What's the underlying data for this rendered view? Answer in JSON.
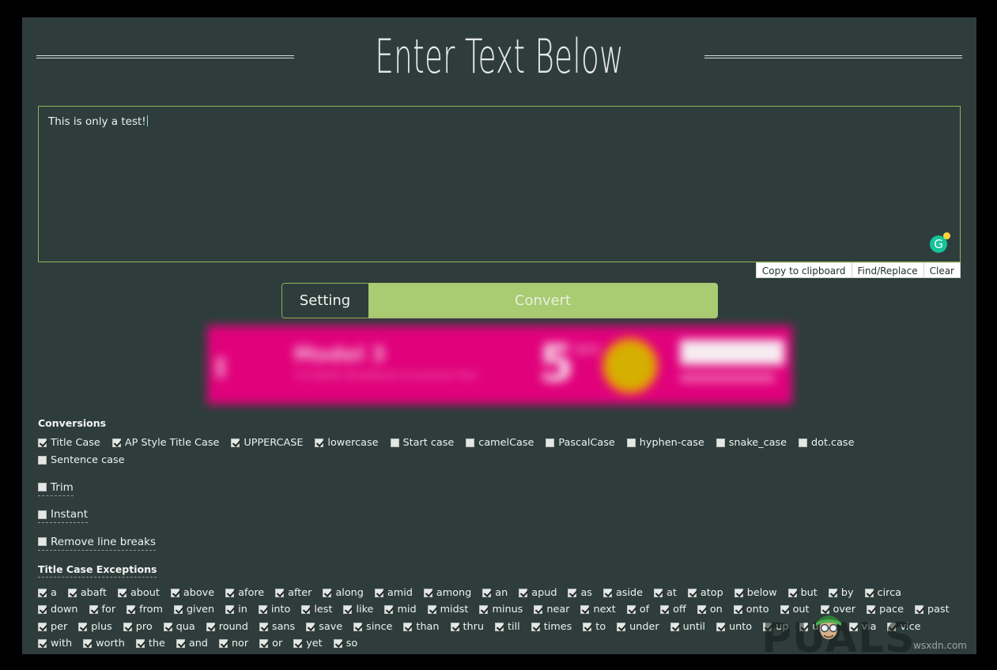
{
  "page": {
    "title": "Enter Text Below",
    "watermark_brand": "PUALS",
    "watermark_site": "wsxdn.com"
  },
  "editor": {
    "text": "This is only a test!",
    "grammarly_icon": "grammarly-g-icon",
    "grammarly_letter": "G",
    "buttons": [
      "Copy to clipboard",
      "Find/Replace",
      "Clear"
    ]
  },
  "actions": {
    "setting_label": "Setting",
    "convert_label": "Convert"
  },
  "ad": {
    "headline": "Model 3",
    "subline": "5G Mobile Broadband Connection Plan",
    "price": "5",
    "price_sup": "$/m"
  },
  "conversions": {
    "heading": "Conversions",
    "items": [
      {
        "label": "Title Case",
        "checked": true
      },
      {
        "label": "AP Style Title Case",
        "checked": true
      },
      {
        "label": "UPPERCASE",
        "checked": true
      },
      {
        "label": "lowercase",
        "checked": true
      },
      {
        "label": "Start case",
        "checked": false
      },
      {
        "label": "camelCase",
        "checked": false
      },
      {
        "label": "PascalCase",
        "checked": false
      },
      {
        "label": "hyphen-case",
        "checked": false
      },
      {
        "label": "snake_case",
        "checked": false
      },
      {
        "label": "dot.case",
        "checked": false
      },
      {
        "label": "Sentence case",
        "checked": false
      }
    ]
  },
  "options": [
    {
      "label": "Trim",
      "checked": false
    },
    {
      "label": "Instant",
      "checked": false
    },
    {
      "label": "Remove line breaks",
      "checked": false
    }
  ],
  "exceptions": {
    "heading": "Title Case Exceptions",
    "items": [
      "a",
      "abaft",
      "about",
      "above",
      "afore",
      "after",
      "along",
      "amid",
      "among",
      "an",
      "apud",
      "as",
      "aside",
      "at",
      "atop",
      "below",
      "but",
      "by",
      "circa",
      "down",
      "for",
      "from",
      "given",
      "in",
      "into",
      "lest",
      "like",
      "mid",
      "midst",
      "minus",
      "near",
      "next",
      "of",
      "off",
      "on",
      "onto",
      "out",
      "over",
      "pace",
      "past",
      "per",
      "plus",
      "pro",
      "qua",
      "round",
      "sans",
      "save",
      "since",
      "than",
      "thru",
      "till",
      "times",
      "to",
      "under",
      "until",
      "unto",
      "up",
      "upon",
      "via",
      "vice",
      "with",
      "worth",
      "the",
      "and",
      "nor",
      "or",
      "yet",
      "so"
    ],
    "all_checked": true
  },
  "colors": {
    "background": "#2e3d3b",
    "accent_green": "#8db356",
    "convert_green": "#a9cb72",
    "ad_magenta": "#e6007e",
    "grammarly_green": "#15c39a"
  }
}
